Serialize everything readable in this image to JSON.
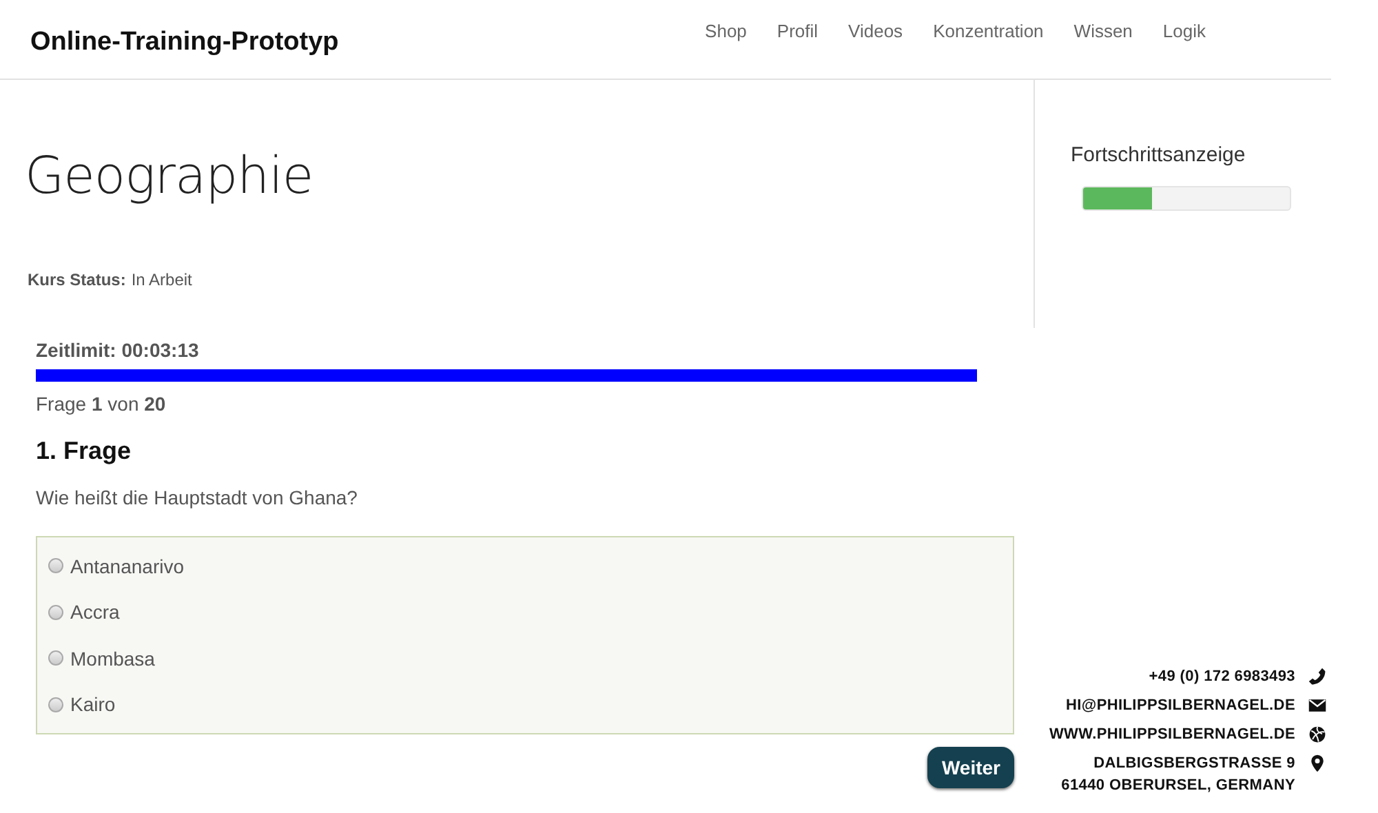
{
  "header": {
    "brand": "Online-Training-Prototyp",
    "nav": [
      {
        "label": "Shop"
      },
      {
        "label": "Profil"
      },
      {
        "label": "Videos"
      },
      {
        "label": "Konzentration"
      },
      {
        "label": "Wissen"
      },
      {
        "label": "Logik"
      }
    ]
  },
  "page": {
    "title": "Geographie",
    "status_label": "Kurs Status:",
    "status_value": "In Arbeit"
  },
  "quiz": {
    "timer": {
      "label": "Zeitlimit: 00:03:13"
    },
    "counter": "Frage **1** von **20**",
    "question_title": "1. Frage",
    "question": "Wie heißt die Hauptstadt von Ghana?",
    "options": [
      {
        "label": "Antananarivo",
        "selected": false
      },
      {
        "label": "Accra",
        "selected": false
      },
      {
        "label": "Mombasa",
        "selected": false
      },
      {
        "label": "Kairo",
        "selected": false
      }
    ],
    "next_button": "Weiter"
  },
  "sidebar": {
    "title": "Fortschrittsanzeige",
    "level": 0.33
  },
  "contact": [
    {
      "kind": "phone",
      "lines": [
        "+49 (0) 172 6983493"
      ]
    },
    {
      "kind": "email",
      "lines": [
        "HI@PHILIPPSILBERNAGEL.DE"
      ]
    },
    {
      "kind": "web",
      "lines": [
        "WWW.PHILIPPSILBERNAGEL.DE"
      ]
    },
    {
      "kind": "address",
      "lines": [
        "DALBIGSBERGSTRASSE 9",
        "61440 OBERURSEL, GERMANY"
      ]
    }
  ]
}
